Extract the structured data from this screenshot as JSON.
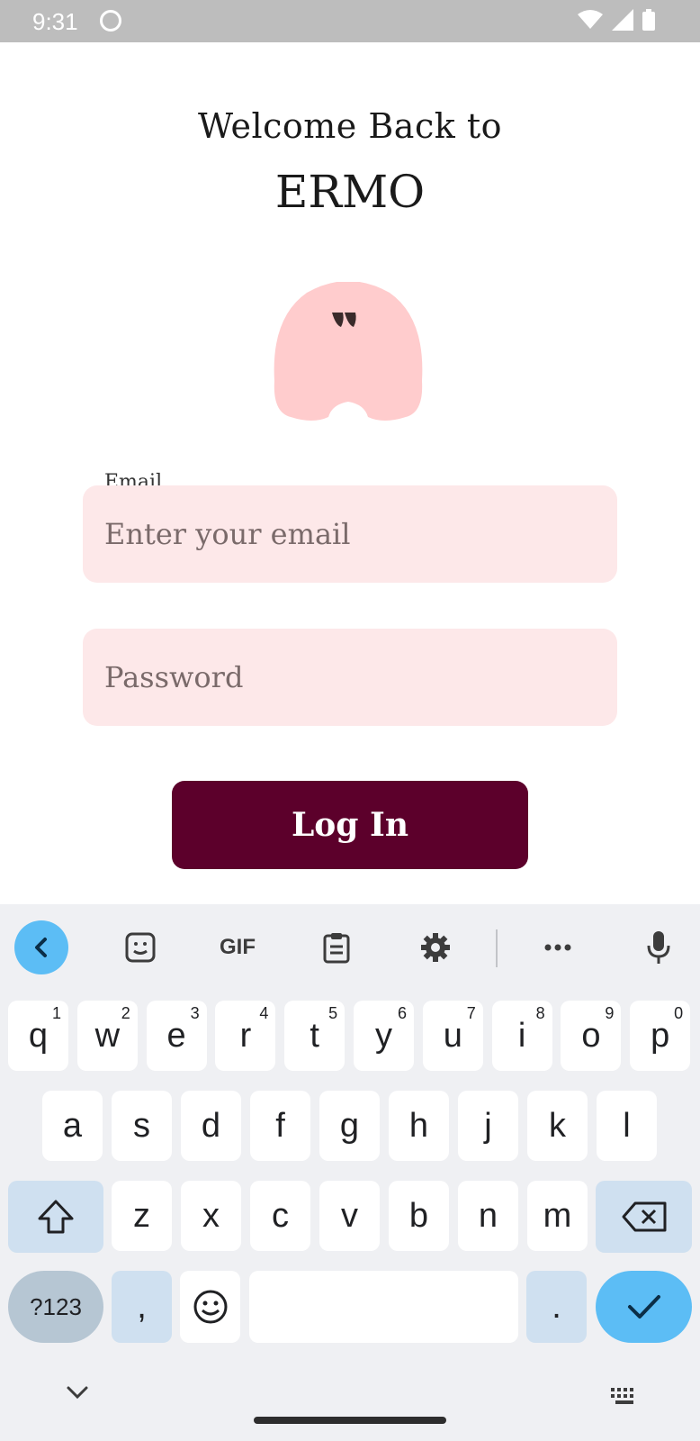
{
  "status_bar": {
    "time": "9:31"
  },
  "header": {
    "welcome": "Welcome Back to",
    "brand": "ERMO"
  },
  "form": {
    "email_label": "Email",
    "email_placeholder": "Enter your email",
    "password_placeholder": "Password",
    "login_label": "Log In"
  },
  "colors": {
    "brand_dark": "#5c002b",
    "field_bg": "#fde8e9",
    "mascot": "#ffcccd",
    "kb_accent": "#5cbdf5"
  },
  "keyboard": {
    "toolbar": {
      "gif_label": "GIF"
    },
    "row1": [
      {
        "k": "q",
        "n": "1"
      },
      {
        "k": "w",
        "n": "2"
      },
      {
        "k": "e",
        "n": "3"
      },
      {
        "k": "r",
        "n": "4"
      },
      {
        "k": "t",
        "n": "5"
      },
      {
        "k": "y",
        "n": "6"
      },
      {
        "k": "u",
        "n": "7"
      },
      {
        "k": "i",
        "n": "8"
      },
      {
        "k": "o",
        "n": "9"
      },
      {
        "k": "p",
        "n": "0"
      }
    ],
    "row2": [
      "a",
      "s",
      "d",
      "f",
      "g",
      "h",
      "j",
      "k",
      "l"
    ],
    "row3": [
      "z",
      "x",
      "c",
      "v",
      "b",
      "n",
      "m"
    ],
    "sym_label": "?123",
    "comma": ",",
    "period": "."
  }
}
